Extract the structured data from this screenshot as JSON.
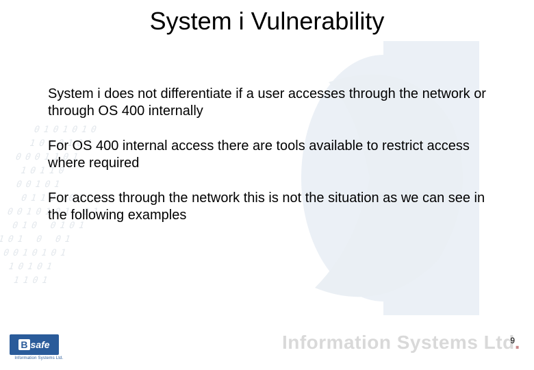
{
  "title": "System i Vulnerability",
  "paragraphs": [
    "System i does not differentiate if a user accesses through the network or through OS 400 internally",
    "For OS 400 internal access there are tools available to restrict access where required",
    "For access through the network this is not the situation as we can see in the following examples"
  ],
  "page_number": "9",
  "footer_brand": "Information Systems Ltd",
  "logo": {
    "text_prefix": "B",
    "text_main": "safe",
    "caption": "Information Systems Ltd."
  },
  "binary_decor": " 0101010\n 1010101\n0001101\n 10110\n 00101\n  0110 01\n 0010101 01\n  010 0101\n 101 0 01\n  0010101\n   10101\n 01 1101"
}
